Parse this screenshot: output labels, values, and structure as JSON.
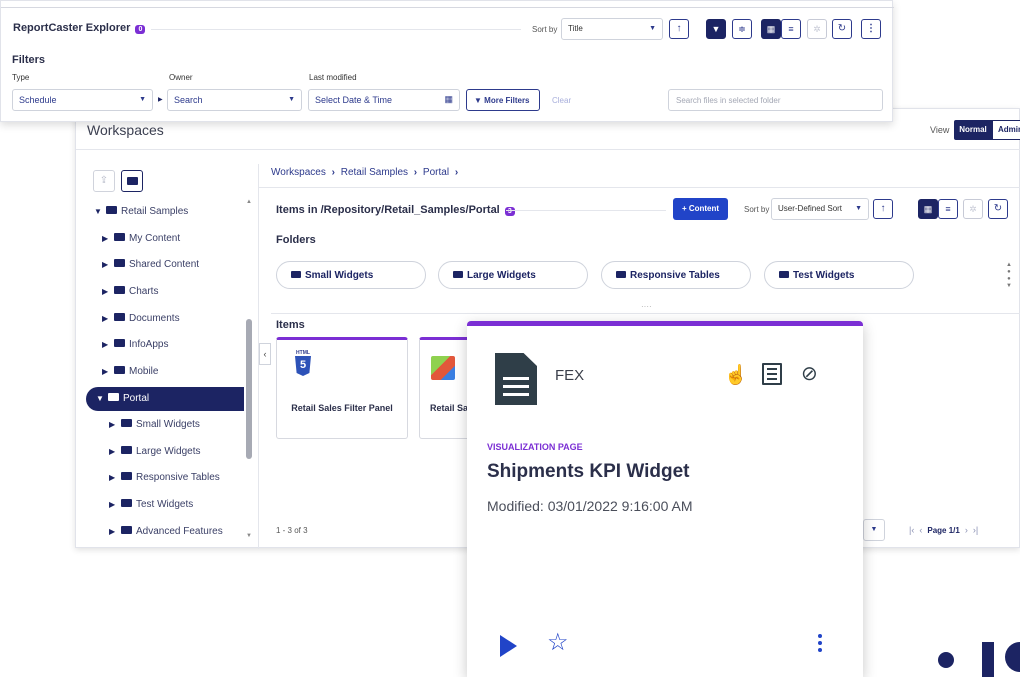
{
  "rc": {
    "title": "ReportCaster Explorer",
    "badge": "0",
    "sort_label": "Sort by",
    "sort_value": "Title",
    "filters_heading": "Filters",
    "type_label": "Type",
    "type_value": "Schedule",
    "owner_label": "Owner",
    "owner_value": "Search",
    "modified_label": "Last modified",
    "modified_value": "Select Date & Time",
    "more_filters": "More Filters",
    "clear": "Clear",
    "search_placeholder": "Search files in selected folder"
  },
  "ws": {
    "title": "Workspaces",
    "view_label": "View",
    "view_normal": "Normal",
    "view_admin": "Admin",
    "breadcrumb": [
      "Workspaces",
      "Retail Samples",
      "Portal"
    ],
    "items_path": "Items in /Repository/Retail_Samples/Portal",
    "items_badge": "3",
    "content_button": "+ Content",
    "sort_label": "Sort by",
    "sort_value": "User-Defined Sort",
    "folders_heading": "Folders",
    "folders": [
      "Small Widgets",
      "Large Widgets",
      "Responsive Tables",
      "Test Widgets"
    ],
    "items_heading": "Items",
    "item_cards": [
      "Retail Sales Filter Panel",
      "Retail Sa"
    ],
    "html_badge": "HTML",
    "count": "1 - 3 of 3",
    "page": "Page 1/1",
    "tree": [
      "Retail Samples",
      "My Content",
      "Shared Content",
      "Charts",
      "Documents",
      "InfoApps",
      "Mobile",
      "Portal",
      "Small Widgets",
      "Large Widgets",
      "Responsive Tables",
      "Test Widgets",
      "Advanced Features"
    ]
  },
  "card": {
    "type": "FEX",
    "category": "VISUALIZATION PAGE",
    "title": "Shipments KPI Widget",
    "modified": "Modified: 03/01/2022 9:16:00 AM"
  },
  "colors": {
    "navy": "#1c2463",
    "accent_blue": "#2d3a8c",
    "purple": "#7b2fd4",
    "card_icon": "#2f3e48"
  }
}
